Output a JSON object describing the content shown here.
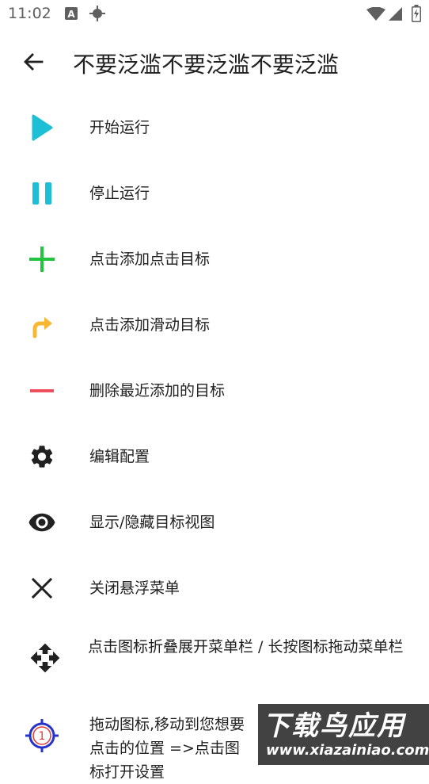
{
  "status_bar": {
    "time": "11:02",
    "icons": [
      "keyboard-a-icon",
      "location-crosshair-icon",
      "wifi-icon",
      "signal-icon",
      "battery-charging-icon"
    ]
  },
  "app_bar": {
    "back_icon": "arrow-back-icon",
    "title": "不要泛滥不要泛滥不要泛滥"
  },
  "colors": {
    "play": "#1cbfd6",
    "pause": "#1cbfd6",
    "add": "#22c43f",
    "swipe": "#f7b733",
    "remove": "#ef5060",
    "dark_icon": "#212121",
    "target": "#2733c8",
    "target_number": "#e53935"
  },
  "menu": {
    "items": [
      {
        "icon": "play-icon",
        "label": "开始运行"
      },
      {
        "icon": "pause-icon",
        "label": "停止运行"
      },
      {
        "icon": "plus-icon",
        "label": "点击添加点击目标"
      },
      {
        "icon": "swipe-arrow-icon",
        "label": "点击添加滑动目标"
      },
      {
        "icon": "minus-icon",
        "label": "删除最近添加的目标"
      },
      {
        "icon": "gear-icon",
        "label": "编辑配置"
      },
      {
        "icon": "eye-icon",
        "label": "显示/隐藏目标视图"
      },
      {
        "icon": "close-icon",
        "label": "关闭悬浮菜单"
      },
      {
        "icon": "move-icon",
        "label": "点击图标折叠展开菜单栏 / 长按图标拖动菜单栏"
      },
      {
        "icon": "target-icon",
        "label": "拖动图标,移动到您想要点击的位置 =>点击图标打开设置",
        "number": "1"
      }
    ]
  },
  "watermark": {
    "title": "下载鸟应用",
    "url": "www.xiazainiao.com"
  }
}
